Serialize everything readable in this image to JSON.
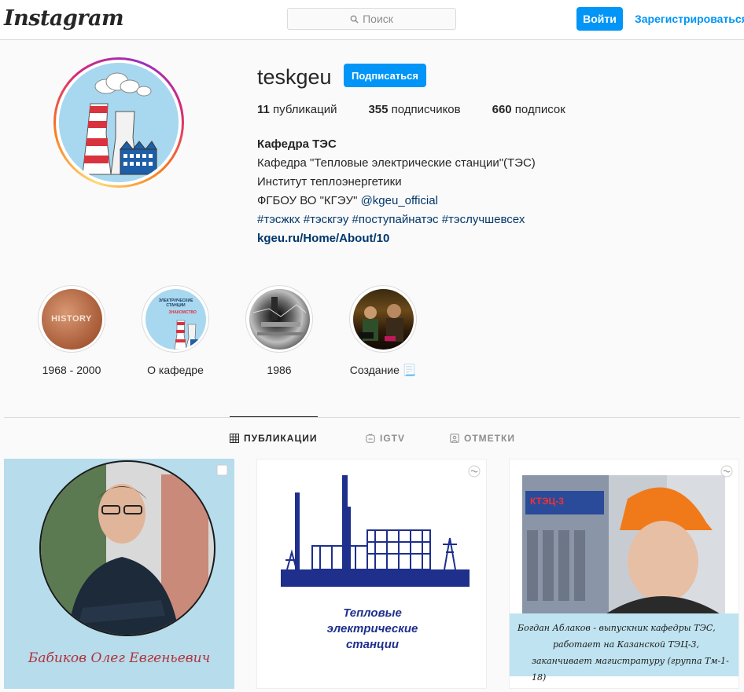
{
  "header": {
    "logo": "Instagram",
    "search_placeholder": "Поиск",
    "login_label": "Войти",
    "signup_label": "Зарегистрироваться"
  },
  "profile": {
    "username": "teskgeu",
    "follow_label": "Подписаться",
    "stats": [
      {
        "count": "11",
        "label": " публикаций"
      },
      {
        "count": "355",
        "label": " подписчиков"
      },
      {
        "count": "660",
        "label": " подписок"
      }
    ],
    "bio": {
      "name": "Кафедра ТЭС",
      "line1": "Кафедра \"Тепловые электрические станции\"(ТЭС)",
      "line2": "Институт теплоэнергетики",
      "line3_prefix": "ФГБОУ ВО \"КГЭУ\" ",
      "line3_mention": "@kgeu_official",
      "hashtags": "#тэсжкх #тэскгэу #поступайнатэс #тэслучшевсех",
      "website": "kgeu.ru/Home/About/10"
    }
  },
  "highlights": [
    {
      "label": "1968 - 2000",
      "icon": "history-cover"
    },
    {
      "label": "О кафедре",
      "icon": "power-plant-cover"
    },
    {
      "label": "1986",
      "icon": "aerial-photo-cover"
    },
    {
      "label": "Создание 📃",
      "icon": "people-photo-cover"
    }
  ],
  "tabs": [
    {
      "label": "ПУБЛИКАЦИИ",
      "icon": "grid-icon",
      "active": true
    },
    {
      "label": "IGTV",
      "icon": "igtv-icon",
      "active": false
    },
    {
      "label": "ОТМЕТКИ",
      "icon": "tagged-icon",
      "active": false
    }
  ],
  "posts": [
    {
      "caption": "Бабиков Олег Евгеньевич",
      "icon": "carousel-icon"
    },
    {
      "caption_line1": "Тепловые",
      "caption_line2": "электрические",
      "caption_line3": "станции",
      "icon": "igtv-post-icon"
    },
    {
      "caption_line1": "Богдан Аблаков - выпускник кафедры ТЭС,",
      "caption_line2": "работает на Казанской ТЭЦ-3,",
      "caption_line3": "заканчивает магистратуру (группа Тм-1-18)",
      "sign_text": "КТЭЦ-3",
      "icon": "igtv-post-icon"
    }
  ],
  "hl_images": {
    "history_text": "HISTORY",
    "about_text_top": "ЭЛЕКТРИЧЕСКИЕ СТАНЦИИ",
    "about_text_sub": "ЗНАКОМСТВО"
  },
  "colors": {
    "accent": "#0095f6",
    "link": "#00376b",
    "text": "#262626",
    "muted": "#8e8e8e"
  }
}
